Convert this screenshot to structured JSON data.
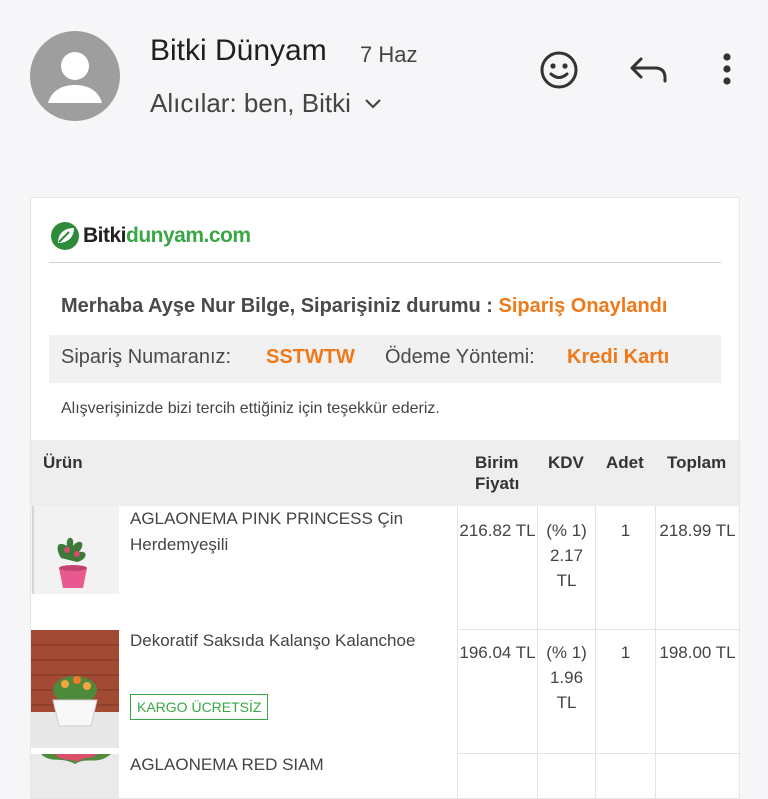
{
  "email": {
    "sender": "Bitki Dünyam",
    "date": "7 Haz",
    "recipients": "Alıcılar: ben, Bitki"
  },
  "logo": {
    "part1": "Bitki",
    "part2": "dunyam.com"
  },
  "greeting": {
    "text": "Merhaba Ayşe Nur Bilge, Siparişiniz durumu : ",
    "status": "Sipariş Onaylandı"
  },
  "order": {
    "number_label": "Sipariş Numaranız:",
    "number": "SSTWTW",
    "payment_label": "Ödeme Yöntemi:",
    "payment": "Kredi Kartı"
  },
  "thanks": "Alışverişinizde bizi tercih ettiğiniz için teşekkür ederiz.",
  "table": {
    "headers": {
      "product": "Ürün",
      "unit_price_1": "Birim",
      "unit_price_2": "Fiyatı",
      "kdv": "KDV",
      "qty": "Adet",
      "total": "Toplam"
    },
    "rows": [
      {
        "name": "AGLAONEMA PINK PRINCESS Çin Herdemyeşili",
        "price": "216.82 TL",
        "kdv_rate": "(% 1)",
        "kdv_amount": "2.17 TL",
        "qty": "1",
        "total": "218.99 TL"
      },
      {
        "name": "Dekoratif Saksıda Kalanşo Kalanchoe",
        "badge": "KARGO ÜCRETSİZ",
        "price": "196.04 TL",
        "kdv_rate": "(% 1)",
        "kdv_amount": "1.96 TL",
        "qty": "1",
        "total": "198.00 TL"
      },
      {
        "name": "AGLAONEMA RED SIAM"
      }
    ]
  },
  "icons": [
    "avatar-person-icon",
    "chevron-down-icon",
    "emoji-smile-icon",
    "reply-icon",
    "more-vert-icon",
    "logo-leaf-icon"
  ]
}
